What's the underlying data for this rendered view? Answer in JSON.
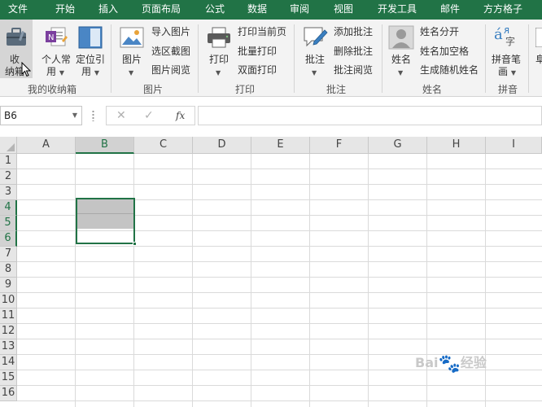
{
  "menu": {
    "tabs": [
      "文件",
      "开始",
      "插入",
      "页面布局",
      "公式",
      "数据",
      "审阅",
      "视图",
      "开发工具",
      "邮件",
      "方方格子"
    ]
  },
  "ribbon": {
    "collection": {
      "storage_l1": "收",
      "storage_l2": "纳箱",
      "personal_l1": "个人常",
      "personal_l2": "用",
      "locate_l1": "定位引",
      "locate_l2": "用",
      "label": "我的收纳箱"
    },
    "picture": {
      "picture_btn": "图片",
      "import": "导入图片",
      "crop": "选区截图",
      "browse": "图片阅览",
      "label": "图片"
    },
    "print": {
      "print_btn": "打印",
      "current": "打印当前页",
      "batch": "批量打印",
      "duplex": "双面打印",
      "label": "打印"
    },
    "comment": {
      "comment_btn": "批注",
      "add": "添加批注",
      "delete": "删除批注",
      "browse": "批注阅览",
      "label": "批注"
    },
    "name": {
      "name_btn": "姓名",
      "split": "姓名分开",
      "space": "姓名加空格",
      "random": "生成随机姓名",
      "label": "姓名"
    },
    "pinyin": {
      "btn_l1": "拼音笔",
      "btn_l2": "画",
      "label": "拼音",
      "glyph_top": "á",
      "glyph_sub": "字"
    },
    "cut_off_label": "阜"
  },
  "formula_bar": {
    "name_box": "B6",
    "cancel": "✕",
    "confirm": "✓",
    "fx": "fx",
    "value": ""
  },
  "sheet": {
    "columns": [
      "A",
      "B",
      "C",
      "D",
      "E",
      "F",
      "G",
      "H",
      "I"
    ],
    "rows": [
      "1",
      "2",
      "3",
      "4",
      "5",
      "6",
      "7",
      "8",
      "9",
      "10",
      "11",
      "12",
      "13",
      "14",
      "15",
      "16"
    ],
    "selected_column": "B",
    "selected_rows": [
      "4",
      "5",
      "6"
    ],
    "active_cell": "B6"
  },
  "watermark": {
    "text": "Bai",
    "text2": "经验"
  },
  "colors": {
    "accent": "#217346",
    "ribbon_bg": "#f3f3f3",
    "selection_fill": "#c4c4c4"
  }
}
